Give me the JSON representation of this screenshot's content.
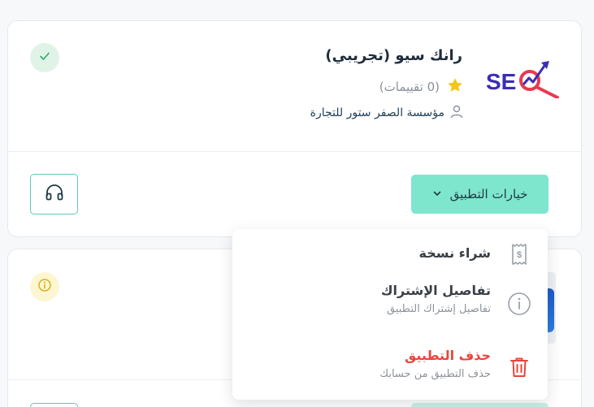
{
  "app": {
    "title": "رانك سيو (تجريبي)",
    "rating_text": "(0 تقييمات)",
    "vendor": "مؤسسة الصفر ستور للتجارة",
    "logo_text": "SEO"
  },
  "actions": {
    "options_label": "خيارات التطبيق"
  },
  "menu": {
    "items": [
      {
        "label": "شراء نسخة",
        "sub": ""
      },
      {
        "label": "تفاصيل الإشتراك",
        "sub": "تفاصيل إشتراك التطبيق"
      },
      {
        "label": "حذف التطبيق",
        "sub": "حذف التطبيق من حسابك"
      }
    ]
  },
  "colors": {
    "accent_green": "#7de6cd",
    "danger": "#e8453c",
    "logo_blue": "#3b2db5",
    "logo_red": "#e83a4f"
  },
  "icons": {
    "status_ok": "check-icon",
    "status_info": "info-icon",
    "star": "star-icon",
    "vendor": "user-icon",
    "support": "headphones-icon",
    "buy": "receipt-icon",
    "details": "info-icon",
    "delete": "trash-icon"
  }
}
